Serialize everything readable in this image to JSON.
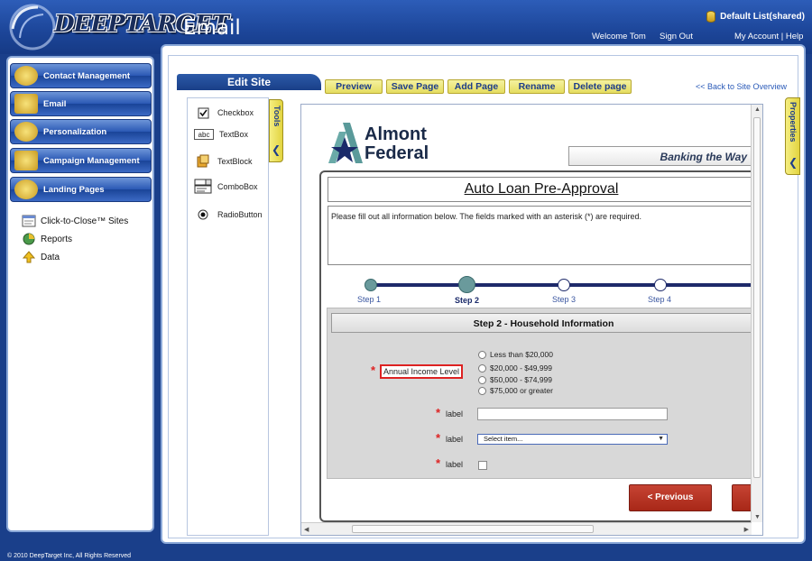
{
  "header": {
    "brand": "DEEPTARGET",
    "product": "Email",
    "list_name": "Default List(shared)",
    "welcome": "Welcome Tom",
    "sign_out": "Sign Out",
    "account_help": "My Account | Help"
  },
  "sidebar": {
    "nav": [
      {
        "label": "Contact Management",
        "icon": "contacts-icon"
      },
      {
        "label": "Email",
        "icon": "email-icon"
      },
      {
        "label": "Personalization",
        "icon": "personalization-icon"
      },
      {
        "label": "Campaign Management",
        "icon": "campaign-icon"
      },
      {
        "label": "Landing Pages",
        "icon": "landing-pages-icon"
      }
    ],
    "links": [
      {
        "label": "Click-to-Close™ Sites",
        "icon": "sites-icon"
      },
      {
        "label": "Reports",
        "icon": "reports-icon"
      },
      {
        "label": "Data",
        "icon": "data-icon"
      }
    ]
  },
  "toolbar": {
    "edit_site": "Edit Site",
    "buttons": [
      "Preview",
      "Save Page",
      "Add Page",
      "Rename",
      "Delete page"
    ],
    "back_link": "<< Back to Site Overview"
  },
  "tools": {
    "tab_label": "Tools",
    "items": [
      {
        "label": "Checkbox",
        "icon": "checkbox-icon"
      },
      {
        "label": "TextBox",
        "icon": "textbox-icon"
      },
      {
        "label": "TextBlock",
        "icon": "textblock-icon"
      },
      {
        "label": "ComboBox",
        "icon": "combobox-icon"
      },
      {
        "label": "RadioButton",
        "icon": "radiobutton-icon"
      }
    ]
  },
  "properties": {
    "tab_label": "Properties"
  },
  "page": {
    "bank_name_line1": "Almont",
    "bank_name_line2": "Federal",
    "tagline": "Banking the Way",
    "form_title": "Auto Loan Pre-Approval",
    "intro": "Please fill out all information below. The fields marked with an asterisk (*) are required.",
    "steps": [
      "Step 1",
      "Step 2",
      "Step 3",
      "Step 4"
    ],
    "active_step": 2,
    "section_title": "Step 2 - Household Information",
    "income_label": "Annual Income Level",
    "income_options": [
      "Less than $20,000",
      "$20,000 - $49,999",
      "$50,000 - $74,999",
      "$75,000 or greater"
    ],
    "field_label": "label",
    "select_placeholder": "Select item...",
    "previous_button": "< Previous"
  },
  "colors": {
    "brand_blue": "#1c4598",
    "accent_yellow": "#e5dd60",
    "button_red": "#a82818",
    "required_red": "#d22222"
  },
  "footer": "© 2010 DeepTarget Inc, All Rights Reserved"
}
